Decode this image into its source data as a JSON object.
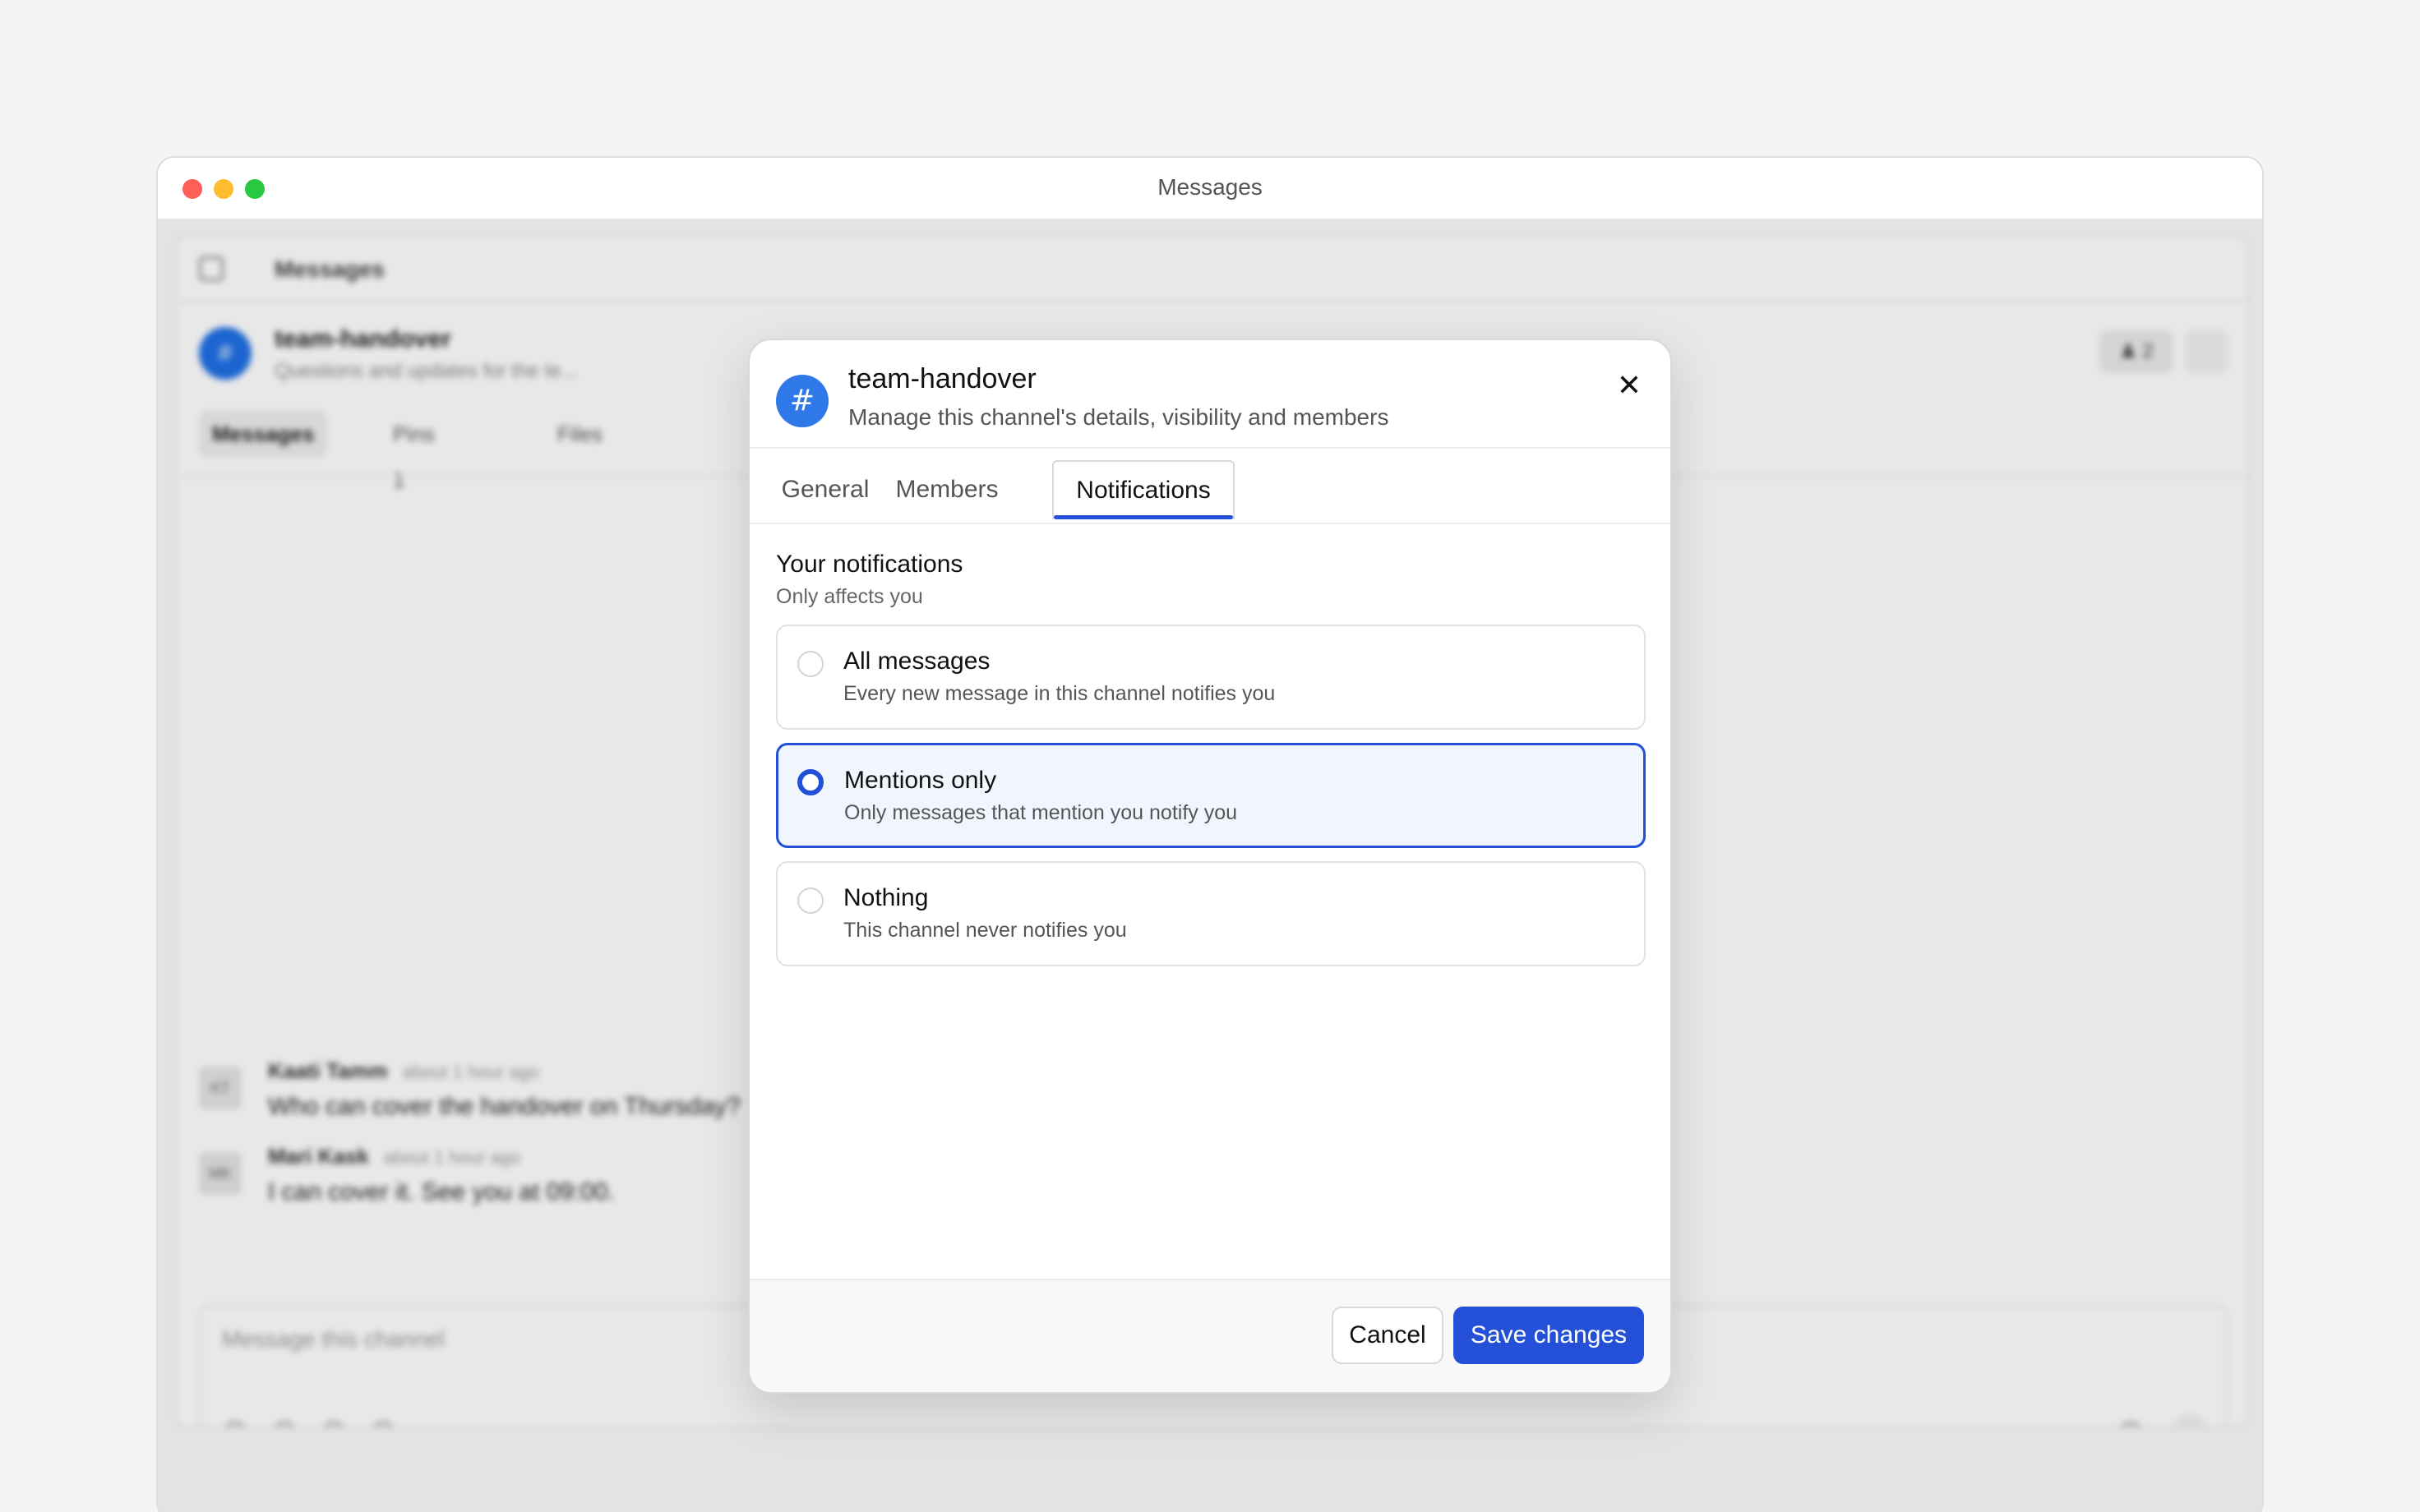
{
  "window": {
    "title": "Messages"
  },
  "background": {
    "breadcrumb": "Messages",
    "channel_avatar": "#",
    "channel_name": "team-handover",
    "channel_desc": "Questions and updates for the te...",
    "member_count": "♟ 2",
    "tabs": [
      {
        "label": "Messages"
      },
      {
        "label": "Pins 1"
      },
      {
        "label": "Files"
      }
    ],
    "messages": [
      {
        "initials": "KT",
        "author": "Kaati Tamm",
        "time": "about 1 hour ago",
        "text": "Who can cover the handover on Thursday?"
      },
      {
        "initials": "MK",
        "author": "Mari Kask",
        "time": "about 1 hour ago",
        "text": "I can cover it. See you at 09:00."
      }
    ],
    "composer_placeholder": "Message this channel"
  },
  "modal": {
    "icon_glyph": "#",
    "title": "team-handover",
    "description": "Manage this channel's details, visibility and members",
    "close_glyph": "✕",
    "tabs": [
      {
        "label": "General"
      },
      {
        "label": "Members"
      },
      {
        "label": "Notifications"
      }
    ],
    "active_tab": "Notifications",
    "section": {
      "title": "Your notifications",
      "subtitle": "Only affects you"
    },
    "options": [
      {
        "label": "All messages",
        "description": "Every new message in this channel notifies you"
      },
      {
        "label": "Mentions only",
        "description": "Only messages that mention you notify you"
      },
      {
        "label": "Nothing",
        "description": "This channel never notifies you"
      }
    ],
    "selected_option": "Mentions only",
    "footer": {
      "cancel_label": "Cancel",
      "save_label": "Save changes"
    }
  },
  "colors": {
    "accent": "#2450d8",
    "channel_icon": "#2f78ea"
  }
}
